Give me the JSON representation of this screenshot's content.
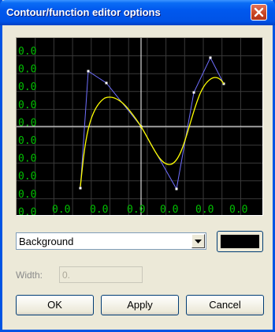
{
  "window": {
    "title": "Contour/function editor options"
  },
  "graph": {
    "y_ticks": [
      "0.0",
      "0.0",
      "0.0",
      "0.0",
      "0.0",
      "0.0",
      "0.0",
      "0.0",
      "0.0",
      "0.0"
    ],
    "x_ticks": [
      "0.0",
      "0.0",
      "0.0",
      "0.0",
      "0.0",
      "0.0"
    ],
    "colors": {
      "background": "#000000",
      "grid": "#3a3a3a",
      "axes": "#ffffff",
      "labels": "#00c000",
      "control_polygon": "#6f6fff",
      "curve": "#ffff00"
    }
  },
  "controls": {
    "element_select": {
      "value": "Background"
    },
    "color_button": {
      "color": "#000000"
    },
    "width": {
      "label": "Width:",
      "value": "0."
    }
  },
  "buttons": {
    "ok": "OK",
    "apply": "Apply",
    "cancel": "Cancel"
  }
}
